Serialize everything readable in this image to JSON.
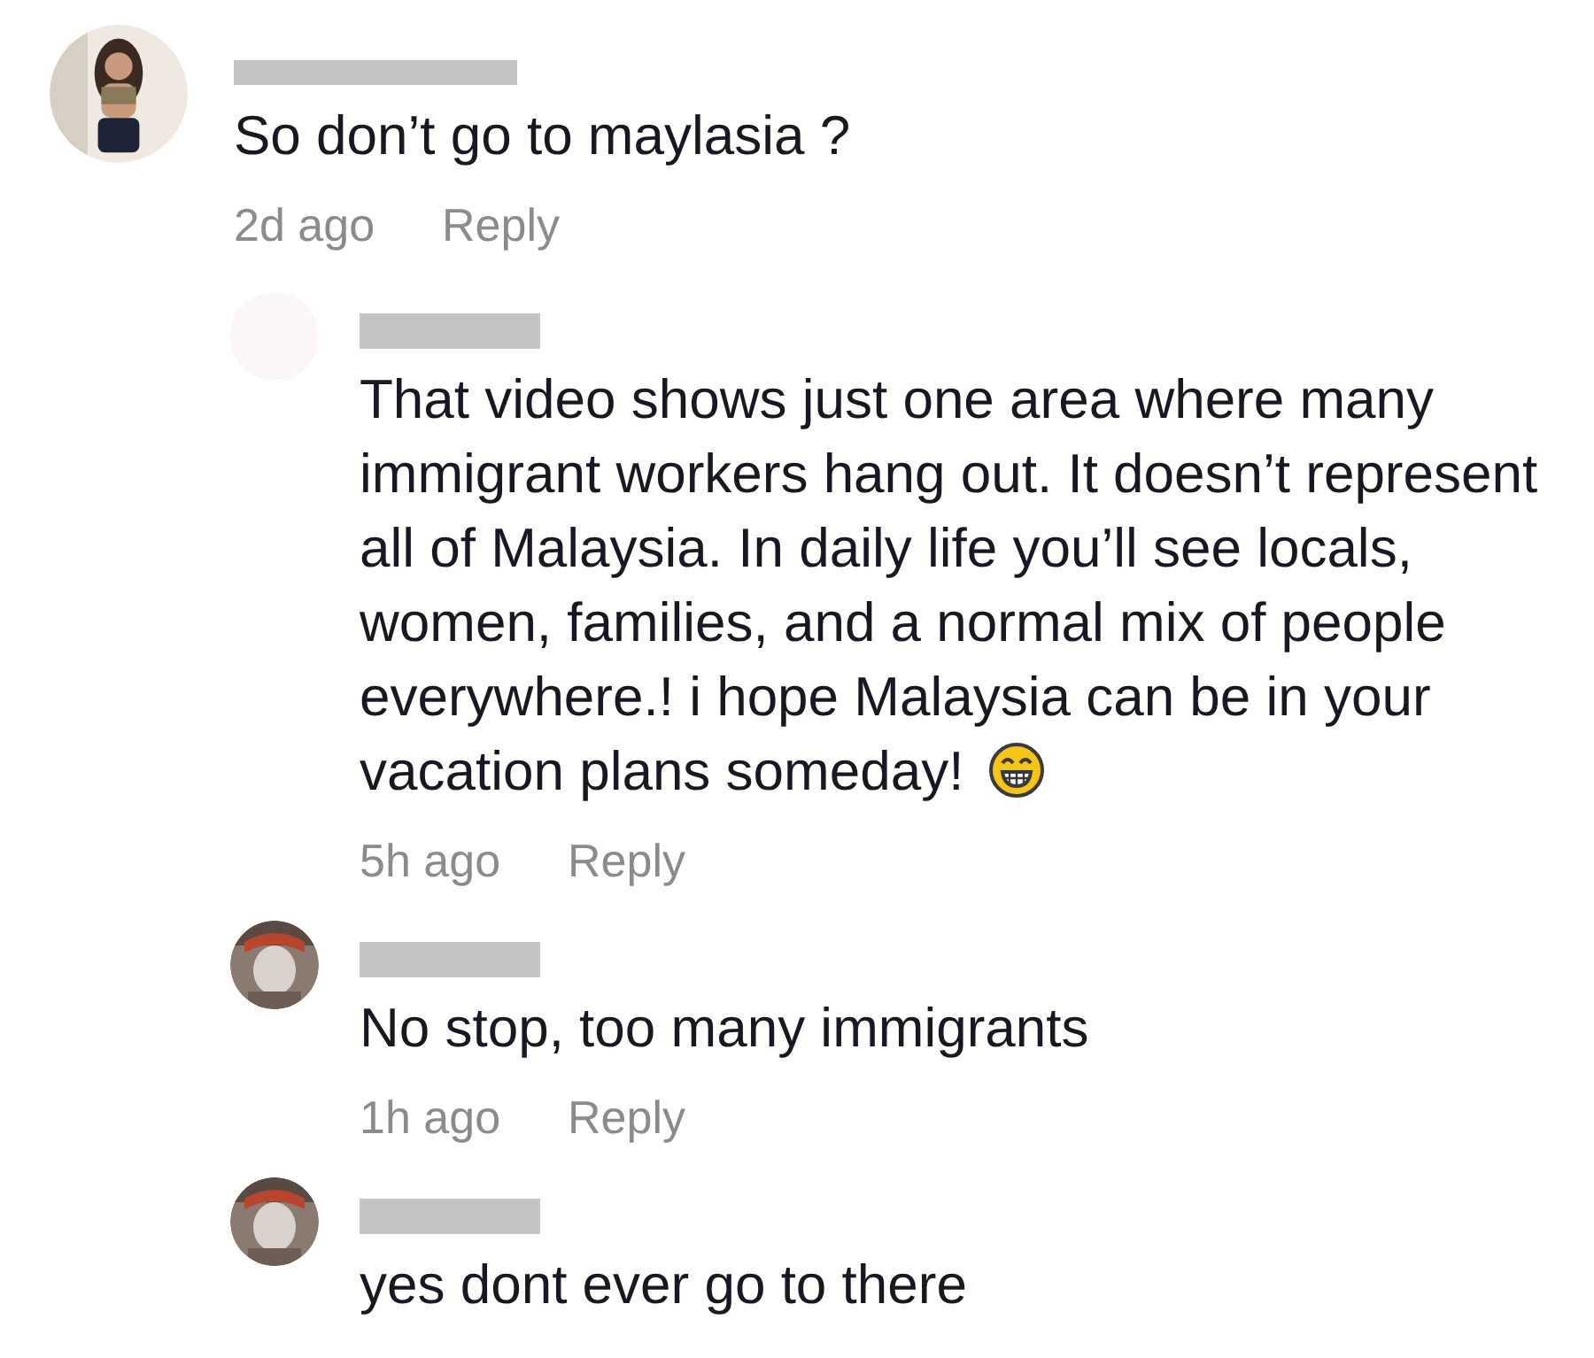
{
  "comments": [
    {
      "name_redacted": true,
      "text": "So don’t go to maylasia ?",
      "time": "2d ago",
      "reply_label": "Reply",
      "replies": [
        {
          "avatar": {
            "kind": "blank"
          },
          "name_redacted": true,
          "text": "That video shows just one area where many immigrant workers hang out. It doesn’t represent all of Malaysia. In daily life you’ll see locals, women, families, and a normal mix of people everywhere.! i hope Malaysia can be in your vacation plans someday!",
          "trailing_emoji": true,
          "time": "5h ago",
          "reply_label": "Reply"
        },
        {
          "name_redacted": true,
          "text": "No stop, too many immigrants",
          "time": "1h ago",
          "reply_label": "Reply"
        },
        {
          "name_redacted": true,
          "text": "yes dont ever go to there"
        }
      ]
    }
  ]
}
